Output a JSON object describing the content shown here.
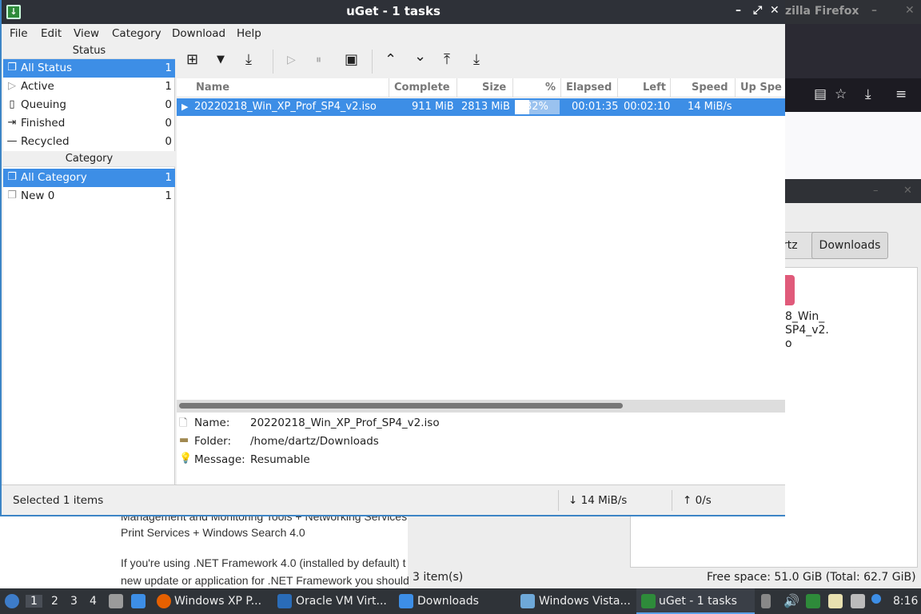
{
  "uget": {
    "title": "uGet - 1 tasks",
    "menu": [
      "File",
      "Edit",
      "View",
      "Category",
      "Download",
      "Help"
    ],
    "status_header": "Status",
    "status_items": [
      {
        "label": "All Status",
        "count": "1",
        "icon": "all-status-icon"
      },
      {
        "label": "Active",
        "count": "1",
        "icon": "play-icon"
      },
      {
        "label": "Queuing",
        "count": "0",
        "icon": "queue-icon"
      },
      {
        "label": "Finished",
        "count": "0",
        "icon": "finish-icon"
      },
      {
        "label": "Recycled",
        "count": "0",
        "icon": "recycle-icon"
      }
    ],
    "category_header": "Category",
    "category_items": [
      {
        "label": "All Category",
        "count": "1"
      },
      {
        "label": "New 0",
        "count": "1"
      }
    ],
    "columns": [
      "Name",
      "Complete",
      "Size",
      "%",
      "Elapsed",
      "Left",
      "Speed",
      "Up Spe"
    ],
    "download": {
      "name": "20220218_Win_XP_Prof_SP4_v2.iso",
      "complete": "911 MiB",
      "size": "2813 MiB",
      "percent": "32%",
      "progress": 0.32,
      "elapsed": "00:01:35",
      "left": "00:02:10",
      "speed": "14 MiB/s"
    },
    "details": {
      "name_label": "Name:",
      "name_value": "20220218_Win_XP_Prof_SP4_v2.iso",
      "folder_label": "Folder:",
      "folder_value": "/home/dartz/Downloads",
      "message_label": "Message:",
      "message_value": "Resumable"
    },
    "statusbar": {
      "selected": "Selected 1 items",
      "down_speed": "↓ 14 MiB/s",
      "up_speed": "↑ 0/s"
    }
  },
  "firefox": {
    "title": "zilla Firefox"
  },
  "filemanager": {
    "crumb_partial": "rtz",
    "crumb_active": "Downloads",
    "file_label_lines": [
      "8_Win_",
      "SP4_v2.",
      "o"
    ],
    "item_count": "3 item(s)",
    "free_space": "Free space: 51.0 GiB (Total: 62.7 GiB)"
  },
  "document": {
    "lines": [
      "Management and Monitoring Tools + Networking Services",
      "Print Services + Windows Search 4.0",
      "If you're using .NET Framework 4.0 (installed by default) t",
      "new update or application for .NET Framework you should"
    ]
  },
  "taskbar": {
    "workspaces": [
      "1",
      "2",
      "3",
      "4"
    ],
    "tasks": [
      "Windows XP P...",
      "Oracle VM Virt...",
      "Downloads",
      "Windows Vista...",
      "uGet - 1 tasks"
    ],
    "clock": "8:16"
  }
}
